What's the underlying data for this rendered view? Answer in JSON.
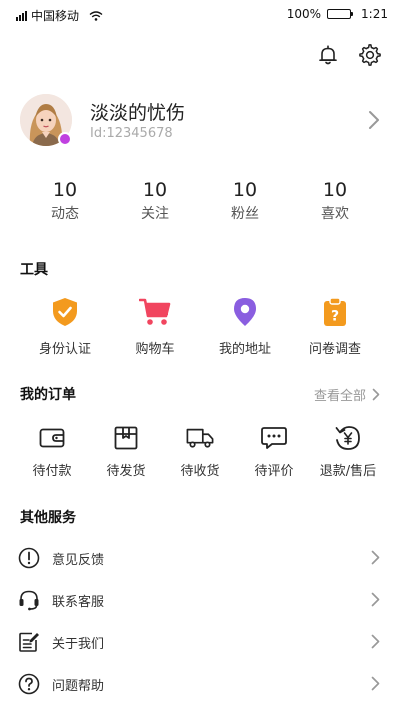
{
  "status_bar": {
    "carrier": "中国移动",
    "battery": "100%",
    "time": "1:21"
  },
  "header": {
    "notification_icon": "bell-icon",
    "settings_icon": "gear-icon"
  },
  "profile": {
    "name": "淡淡的忧伤",
    "id": "Id:12345678"
  },
  "stats": [
    {
      "value": "10",
      "label": "动态"
    },
    {
      "value": "10",
      "label": "关注"
    },
    {
      "value": "10",
      "label": "粉丝"
    },
    {
      "value": "10",
      "label": "喜欢"
    }
  ],
  "tools": {
    "title": "工具",
    "items": [
      {
        "label": "身份认证",
        "icon": "shield-check-icon",
        "color": "#f39a1e"
      },
      {
        "label": "购物车",
        "icon": "cart-icon",
        "color": "#f1455f"
      },
      {
        "label": "我的地址",
        "icon": "location-pin-icon",
        "color": "#8a5ee0"
      },
      {
        "label": "问卷调查",
        "icon": "clipboard-question-icon",
        "color": "#f39a1e"
      }
    ]
  },
  "orders": {
    "title": "我的订单",
    "view_all": "查看全部",
    "items": [
      {
        "label": "待付款",
        "icon": "wallet-icon"
      },
      {
        "label": "待发货",
        "icon": "package-icon"
      },
      {
        "label": "待收货",
        "icon": "truck-icon"
      },
      {
        "label": "待评价",
        "icon": "comment-icon"
      },
      {
        "label": "退款/售后",
        "icon": "refund-icon"
      }
    ]
  },
  "services": {
    "title": "其他服务",
    "items": [
      {
        "label": "意见反馈",
        "icon": "exclamation-circle-icon"
      },
      {
        "label": "联系客服",
        "icon": "headset-icon"
      },
      {
        "label": "关于我们",
        "icon": "edit-note-icon"
      },
      {
        "label": "问题帮助",
        "icon": "question-circle-icon"
      }
    ]
  }
}
